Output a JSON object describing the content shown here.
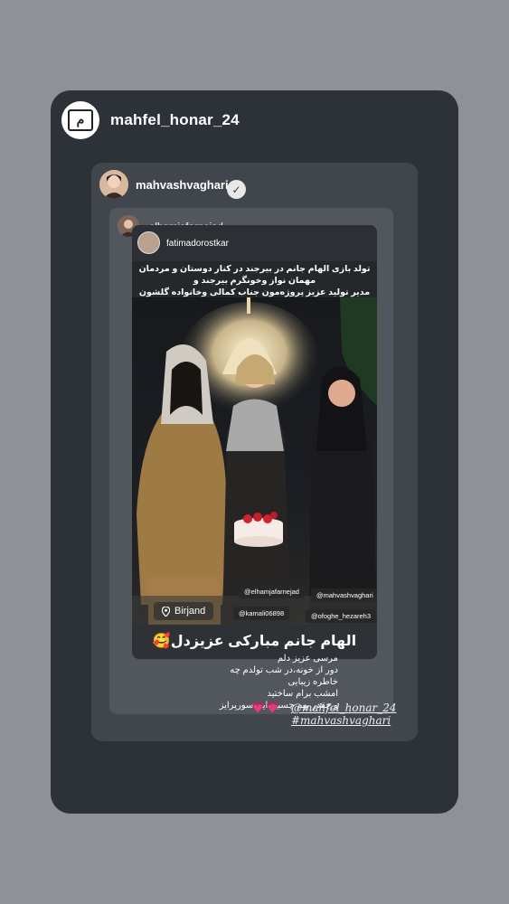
{
  "outer": {
    "username": "mahfel_honar_24",
    "avatar_icon": "logo-icon"
  },
  "repost": {
    "username": "mahvashvaghari",
    "verified_icon": "verified-check-icon"
  },
  "nested_repost": {
    "username": "elhamjafarnejad"
  },
  "story": {
    "username": "fatimadorostkar",
    "caption_lines": [
      "تولد بازی الهام جانم در بیرجند در کنار دوستان و مردمان",
      "مهمان نواز وخونگرم بیرجند و",
      "مدیر تولید عزیز پروژه‌مون جناب کمالی وخانواده گلشون"
    ],
    "location": "Birjand",
    "location_icon": "location-pin-icon",
    "tags": [
      "@elhamjafarnejad",
      "@mahvashvaghari",
      "@kamali06898",
      "@ofoghe_hezareh3"
    ],
    "banner": "الهام جانم مبارکی عزیزدل🥰"
  },
  "reply": {
    "lines": [
      "مرسی عزیز دلم",
      "دور از خونه،در شب تولدم چه خاطره زیبایی",
      "امشب برام ساختید",
      "و چقدر بهم چسبید این سورپرایز"
    ],
    "hearts": "💗💗"
  },
  "credits": {
    "line1": "@mahfel_honar_24",
    "line2": "#mahvashvaghari"
  },
  "colors": {
    "background": "#8e9196",
    "outer_card": "#2d3138",
    "repost_card": "#41454c",
    "nested_card": "#52565d",
    "heart": "#e5527a"
  }
}
